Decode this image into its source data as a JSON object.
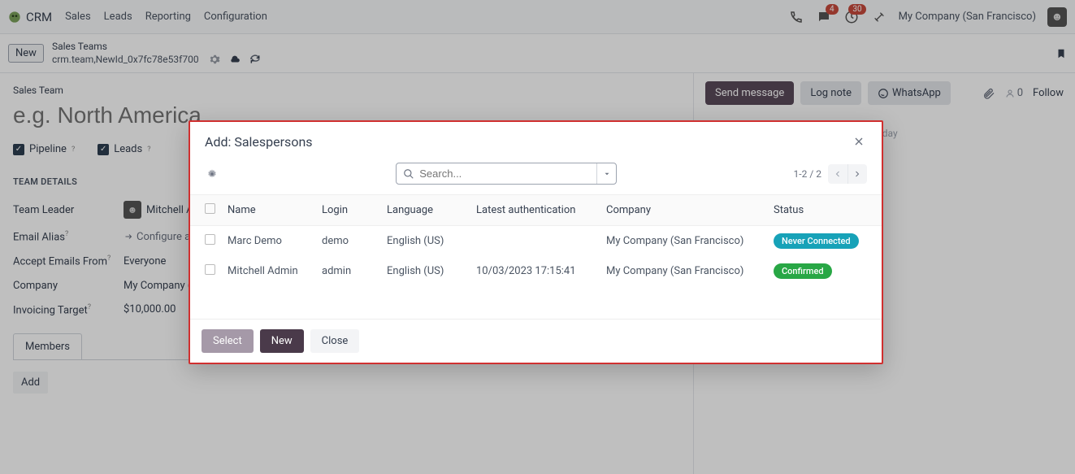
{
  "topnav": {
    "brand": "CRM",
    "items": [
      "Sales",
      "Leads",
      "Reporting",
      "Configuration"
    ],
    "msg_badge": "4",
    "clock_badge": "30",
    "company": "My Company (San Francisco)"
  },
  "controlrow": {
    "new": "New",
    "bc_top": "Sales Teams",
    "bc_bottom": "crm.team,NewId_0x7fc78e53f700"
  },
  "form": {
    "label": "Sales Team",
    "placeholder": "e.g. North America",
    "pipeline": "Pipeline",
    "leads": "Leads",
    "team_details": "TEAM DETAILS",
    "fields": {
      "team_leader_lab": "Team Leader",
      "team_leader_val": "Mitchell Admin",
      "email_alias_lab": "Email Alias",
      "email_alias_val": "Configure alias",
      "accept_from_lab": "Accept Emails From",
      "accept_from_val": "Everyone",
      "company_lab": "Company",
      "company_val": "My Company (San Francisco)",
      "invoicing_lab": "Invoicing Target",
      "invoicing_val": "$10,000.00"
    },
    "tab_members": "Members",
    "add": "Add"
  },
  "chatter": {
    "send": "Send message",
    "log": "Log note",
    "whatsapp": "WhatsApp",
    "follow": "Follow",
    "follower_count": "0",
    "today": "Today"
  },
  "modal": {
    "title": "Add: Salespersons",
    "search_placeholder": "Search...",
    "pager": "1-2 / 2",
    "headers": {
      "name": "Name",
      "login": "Login",
      "language": "Language",
      "auth": "Latest authentication",
      "company": "Company",
      "status": "Status"
    },
    "rows": [
      {
        "name": "Marc Demo",
        "login": "demo",
        "language": "English (US)",
        "auth": "",
        "company": "My Company (San Francisco)",
        "status": "Never Connected",
        "status_class": "pill-teal"
      },
      {
        "name": "Mitchell Admin",
        "login": "admin",
        "language": "English (US)",
        "auth": "10/03/2023 17:15:41",
        "company": "My Company (San Francisco)",
        "status": "Confirmed",
        "status_class": "pill-green"
      }
    ],
    "footer": {
      "select": "Select",
      "new": "New",
      "close": "Close"
    }
  }
}
